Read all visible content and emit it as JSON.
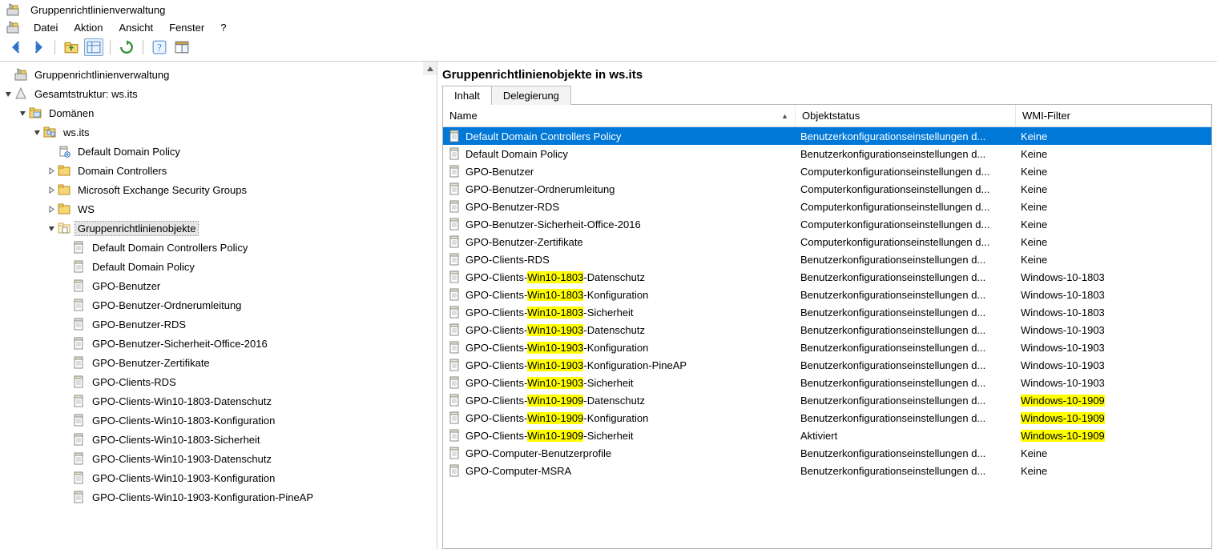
{
  "title": "Gruppenrichtlinienverwaltung",
  "menu": [
    "Datei",
    "Aktion",
    "Ansicht",
    "Fenster",
    "?"
  ],
  "tree": {
    "root": "Gruppenrichtlinienverwaltung",
    "forest": "Gesamtstruktur: ws.its",
    "domains": "Domänen",
    "domain": "ws.its",
    "defaultDomainPolicy": "Default Domain Policy",
    "domainControllers": "Domain Controllers",
    "mesg": "Microsoft Exchange Security Groups",
    "ws": "WS",
    "gpoContainer": "Gruppenrichtlinienobjekte",
    "gpoItems": [
      "Default Domain Controllers Policy",
      "Default Domain Policy",
      "GPO-Benutzer",
      "GPO-Benutzer-Ordnerumleitung",
      "GPO-Benutzer-RDS",
      "GPO-Benutzer-Sicherheit-Office-2016",
      "GPO-Benutzer-Zertifikate",
      "GPO-Clients-RDS",
      "GPO-Clients-Win10-1803-Datenschutz",
      "GPO-Clients-Win10-1803-Konfiguration",
      "GPO-Clients-Win10-1803-Sicherheit",
      "GPO-Clients-Win10-1903-Datenschutz",
      "GPO-Clients-Win10-1903-Konfiguration",
      "GPO-Clients-Win10-1903-Konfiguration-PineAP"
    ]
  },
  "right": {
    "heading": "Gruppenrichtlinienobjekte in ws.its",
    "tabs": [
      "Inhalt",
      "Delegierung"
    ],
    "columns": {
      "name": "Name",
      "status": "Objektstatus",
      "wmi": "WMI-Filter"
    },
    "status": {
      "user": "Benutzerkonfigurationseinstellungen d...",
      "computer": "Computerkonfigurationseinstellungen d...",
      "enabled": "Aktiviert"
    },
    "wmi": {
      "none": "Keine"
    },
    "rows": [
      {
        "name": [
          [
            "",
            "Default Domain Controllers Policy"
          ]
        ],
        "status": "user",
        "wmi": "Keine",
        "wmiHL": false,
        "sel": true
      },
      {
        "name": [
          [
            "",
            "Default Domain Policy"
          ]
        ],
        "status": "user",
        "wmi": "Keine",
        "wmiHL": false
      },
      {
        "name": [
          [
            "",
            "GPO-Benutzer"
          ]
        ],
        "status": "computer",
        "wmi": "Keine",
        "wmiHL": false
      },
      {
        "name": [
          [
            "",
            "GPO-Benutzer-Ordnerumleitung"
          ]
        ],
        "status": "computer",
        "wmi": "Keine",
        "wmiHL": false
      },
      {
        "name": [
          [
            "",
            "GPO-Benutzer-RDS"
          ]
        ],
        "status": "computer",
        "wmi": "Keine",
        "wmiHL": false
      },
      {
        "name": [
          [
            "",
            "GPO-Benutzer-Sicherheit-Office-2016"
          ]
        ],
        "status": "computer",
        "wmi": "Keine",
        "wmiHL": false
      },
      {
        "name": [
          [
            "",
            "GPO-Benutzer-Zertifikate"
          ]
        ],
        "status": "computer",
        "wmi": "Keine",
        "wmiHL": false
      },
      {
        "name": [
          [
            "",
            "GPO-Clients-RDS"
          ]
        ],
        "status": "user",
        "wmi": "Keine",
        "wmiHL": false
      },
      {
        "name": [
          [
            "",
            "GPO-Clients-"
          ],
          [
            "hl",
            "Win10-1803"
          ],
          [
            "",
            "-Datenschutz"
          ]
        ],
        "status": "user",
        "wmi": "Windows-10-1803",
        "wmiHL": false
      },
      {
        "name": [
          [
            "",
            "GPO-Clients-"
          ],
          [
            "hl",
            "Win10-1803"
          ],
          [
            "",
            "-Konfiguration"
          ]
        ],
        "status": "user",
        "wmi": "Windows-10-1803",
        "wmiHL": false
      },
      {
        "name": [
          [
            "",
            "GPO-Clients-"
          ],
          [
            "hl",
            "Win10-1803"
          ],
          [
            "",
            "-Sicherheit"
          ]
        ],
        "status": "user",
        "wmi": "Windows-10-1803",
        "wmiHL": false
      },
      {
        "name": [
          [
            "",
            "GPO-Clients-"
          ],
          [
            "hl",
            "Win10-1903"
          ],
          [
            "",
            "-Datenschutz"
          ]
        ],
        "status": "user",
        "wmi": "Windows-10-1903",
        "wmiHL": false
      },
      {
        "name": [
          [
            "",
            "GPO-Clients-"
          ],
          [
            "hl",
            "Win10-1903"
          ],
          [
            "",
            "-Konfiguration"
          ]
        ],
        "status": "user",
        "wmi": "Windows-10-1903",
        "wmiHL": false
      },
      {
        "name": [
          [
            "",
            "GPO-Clients-"
          ],
          [
            "hl",
            "Win10-1903"
          ],
          [
            "",
            "-Konfiguration-PineAP"
          ]
        ],
        "status": "user",
        "wmi": "Windows-10-1903",
        "wmiHL": false
      },
      {
        "name": [
          [
            "",
            "GPO-Clients-"
          ],
          [
            "hl",
            "Win10-1903"
          ],
          [
            "",
            "-Sicherheit"
          ]
        ],
        "status": "user",
        "wmi": "Windows-10-1903",
        "wmiHL": false
      },
      {
        "name": [
          [
            "",
            "GPO-Clients-"
          ],
          [
            "hl",
            "Win10-1909"
          ],
          [
            "",
            "-Datenschutz"
          ]
        ],
        "status": "user",
        "wmi": "Windows-10-1909",
        "wmiHL": true
      },
      {
        "name": [
          [
            "",
            "GPO-Clients-"
          ],
          [
            "hl",
            "Win10-1909"
          ],
          [
            "",
            "-Konfiguration"
          ]
        ],
        "status": "user",
        "wmi": "Windows-10-1909",
        "wmiHL": true
      },
      {
        "name": [
          [
            "",
            "GPO-Clients-"
          ],
          [
            "hl",
            "Win10-1909"
          ],
          [
            "",
            "-Sicherheit"
          ]
        ],
        "status": "enabled",
        "wmi": "Windows-10-1909",
        "wmiHL": true
      },
      {
        "name": [
          [
            "",
            "GPO-Computer-Benutzerprofile"
          ]
        ],
        "status": "user",
        "wmi": "Keine",
        "wmiHL": false
      },
      {
        "name": [
          [
            "",
            "GPO-Computer-MSRA"
          ]
        ],
        "status": "user",
        "wmi": "Keine",
        "wmiHL": false
      }
    ]
  }
}
